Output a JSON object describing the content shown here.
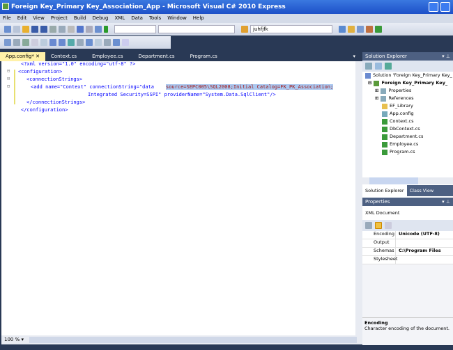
{
  "window": {
    "title": "Foreign Key_Primary Key_Association_App - Microsoft Visual C# 2010 Express"
  },
  "menu": [
    "File",
    "Edit",
    "View",
    "Project",
    "Build",
    "Debug",
    "XML",
    "Data",
    "Tools",
    "Window",
    "Help"
  ],
  "toolbar": {
    "search_value": "juhfjfk"
  },
  "tabs": [
    {
      "label": "App.config*",
      "active": true
    },
    {
      "label": "Context.cs"
    },
    {
      "label": "Employee.cs"
    },
    {
      "label": "Department.cs"
    },
    {
      "label": "Program.cs"
    }
  ],
  "editor": {
    "lines": [
      "<?xml version=\"1.0\" encoding=\"utf-8\" ?>",
      "<configuration>",
      "<connectionStrings>",
      "<add name=\"Context\" connectionString=\"data ",
      "source=SEPC005\\SQL2008;Initial Catalog=FK_PK_Association;",
      "Integrated Security=SSPI\" providerName=\"System.Data.SqlClient\"/>",
      "</connectionStrings>",
      "</configuration>"
    ],
    "zoom": "100 %"
  },
  "solution_explorer": {
    "title": "Solution Explorer",
    "items": [
      "Solution 'Foreign Key_Primary Key_",
      "Foreign Key_Primary Key_",
      "Properties",
      "References",
      "EF_Library",
      "App.config",
      "Context.cs",
      "DbContext.cs",
      "Department.cs",
      "Employee.cs",
      "Program.cs"
    ],
    "tabs": [
      "Solution Explorer",
      "Class View"
    ]
  },
  "properties": {
    "title": "Properties",
    "object": "XML Document",
    "rows": [
      {
        "name": "Encoding",
        "value": "Unicode (UTF-8)"
      },
      {
        "name": "Output",
        "value": ""
      },
      {
        "name": "Schemas",
        "value": "C:\\Program Files"
      },
      {
        "name": "Stylesheet",
        "value": ""
      }
    ],
    "desc_title": "Encoding",
    "desc_text": "Character encoding of the document."
  }
}
